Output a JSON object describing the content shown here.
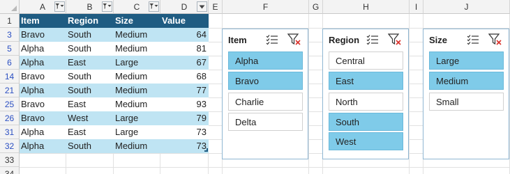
{
  "columns": [
    "A",
    "B",
    "C",
    "D",
    "E",
    "F",
    "G",
    "H",
    "I",
    "J"
  ],
  "row_numbers": [
    {
      "n": "1",
      "filtered": false
    },
    {
      "n": "3",
      "filtered": true
    },
    {
      "n": "5",
      "filtered": true
    },
    {
      "n": "6",
      "filtered": true
    },
    {
      "n": "14",
      "filtered": true
    },
    {
      "n": "21",
      "filtered": true
    },
    {
      "n": "25",
      "filtered": true
    },
    {
      "n": "26",
      "filtered": true
    },
    {
      "n": "31",
      "filtered": true
    },
    {
      "n": "32",
      "filtered": true
    },
    {
      "n": "33",
      "filtered": false
    },
    {
      "n": "34",
      "filtered": false
    }
  ],
  "table": {
    "headers": [
      "Item",
      "Region",
      "Size",
      "Value"
    ],
    "rows": [
      [
        "Bravo",
        "South",
        "Medium",
        "64"
      ],
      [
        "Alpha",
        "South",
        "Medium",
        "81"
      ],
      [
        "Alpha",
        "East",
        "Large",
        "67"
      ],
      [
        "Bravo",
        "South",
        "Medium",
        "68"
      ],
      [
        "Alpha",
        "South",
        "Medium",
        "77"
      ],
      [
        "Bravo",
        "East",
        "Medium",
        "93"
      ],
      [
        "Bravo",
        "West",
        "Large",
        "79"
      ],
      [
        "Alpha",
        "East",
        "Large",
        "73"
      ],
      [
        "Alpha",
        "South",
        "Medium",
        "73"
      ]
    ]
  },
  "slicers": [
    {
      "title": "Item",
      "items": [
        {
          "label": "Alpha",
          "selected": true
        },
        {
          "label": "Bravo",
          "selected": true
        },
        {
          "label": "Charlie",
          "selected": false
        },
        {
          "label": "Delta",
          "selected": false
        }
      ]
    },
    {
      "title": "Region",
      "items": [
        {
          "label": "Central",
          "selected": false
        },
        {
          "label": "East",
          "selected": true
        },
        {
          "label": "North",
          "selected": false
        },
        {
          "label": "South",
          "selected": true
        },
        {
          "label": "West",
          "selected": true
        }
      ]
    },
    {
      "title": "Size",
      "items": [
        {
          "label": "Large",
          "selected": true
        },
        {
          "label": "Medium",
          "selected": true
        },
        {
          "label": "Small",
          "selected": false
        }
      ]
    }
  ],
  "colors": {
    "header_fill": "#1f5c82",
    "band_fill": "#bfe4f3",
    "slicer_selected": "#7fcbe9",
    "filtered_row_number": "#2b4fc2"
  },
  "icons": [
    "multi-select-icon",
    "clear-filter-icon",
    "filter-dropdown-icon",
    "dropdown-arrow-icon"
  ]
}
